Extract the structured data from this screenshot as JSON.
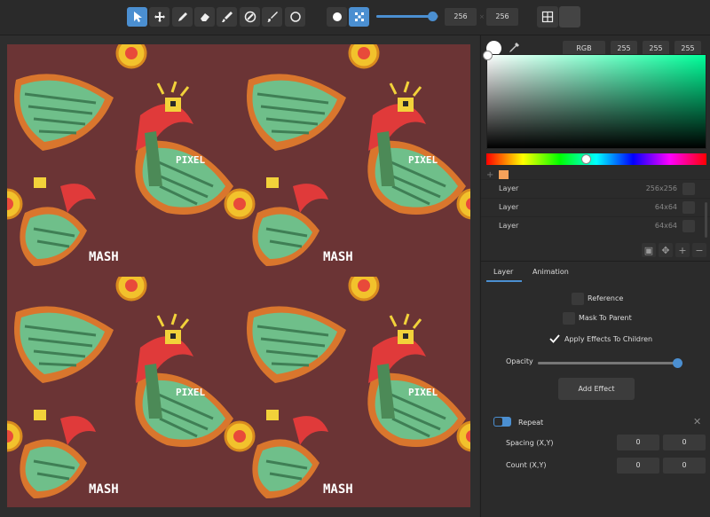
{
  "toolbar": {
    "tools": [
      "select-tool",
      "move-tool",
      "pencil-tool",
      "eraser-tool",
      "brush-tool",
      "fill-tool",
      "smudge-tool",
      "circle-tool"
    ],
    "shape_tools": [
      "dot-brush",
      "pixel-brush"
    ],
    "brush_size_fraction": 0.9,
    "brush_size": "256",
    "brush_size2": "256",
    "view_buttons": [
      "grid-view",
      "single-view"
    ]
  },
  "color": {
    "mode": "RGB",
    "r": "255",
    "g": "255",
    "b": "255",
    "accent": "#4b8fd1",
    "swatch": "#f5a15a",
    "hue_fraction": 0.45
  },
  "layers": [
    {
      "name": "Layer",
      "size": "256x256"
    },
    {
      "name": "Layer",
      "size": "64x64"
    },
    {
      "name": "Layer",
      "size": "64x64"
    }
  ],
  "tabs": {
    "layer": "Layer",
    "animation": "Animation"
  },
  "props": {
    "reference": "Reference",
    "mask": "Mask To Parent",
    "apply": "Apply Effects To Children",
    "opacity": "Opacity",
    "opacity_fraction": 0.98,
    "add_effect": "Add Effect"
  },
  "effect": {
    "name": "Repeat",
    "spacing_label": "Spacing (X,Y)",
    "spacing_x": "0",
    "spacing_y": "0",
    "count_label": "Count (X,Y)",
    "count_x": "0",
    "count_y": "0"
  },
  "canvas_text": [
    "PIXEL",
    "MASH"
  ]
}
